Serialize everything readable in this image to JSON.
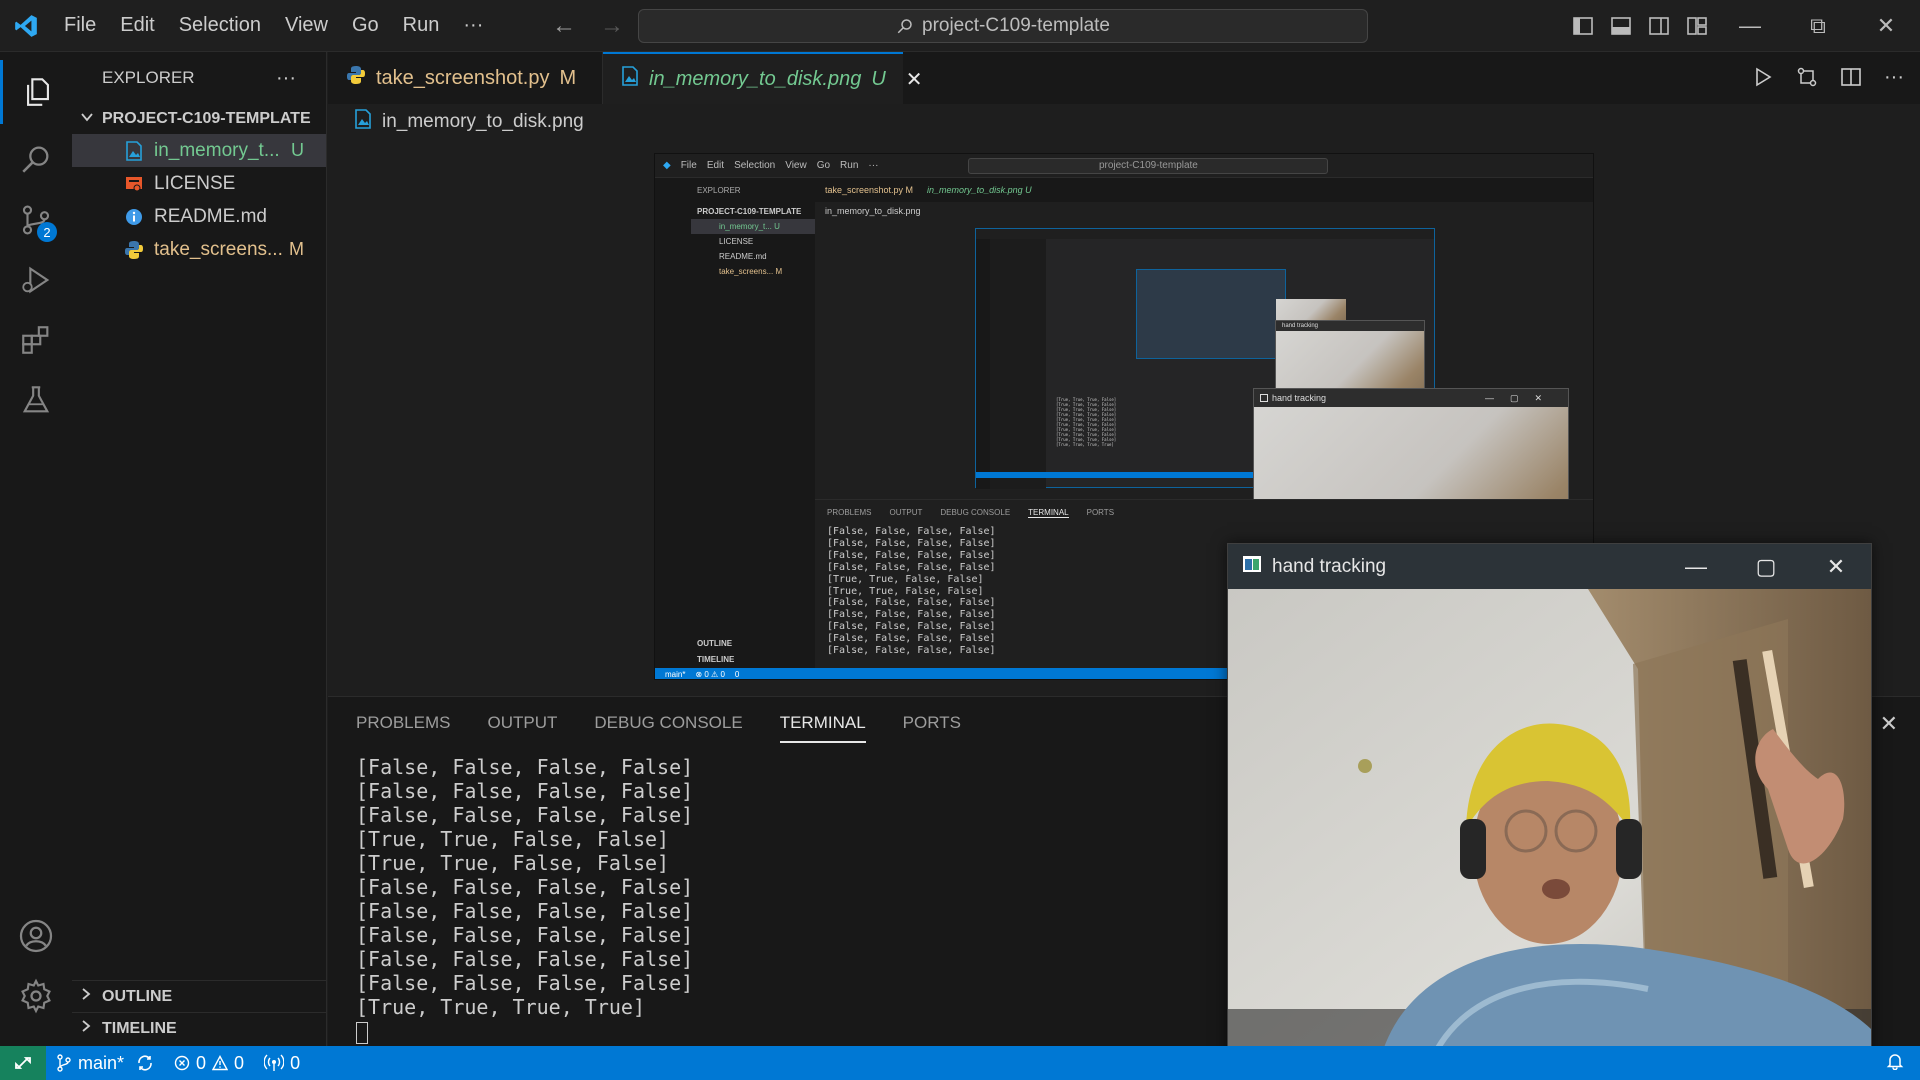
{
  "titlebar": {
    "menu": [
      "File",
      "Edit",
      "Selection",
      "View",
      "Go",
      "Run",
      "···"
    ],
    "search_text": "project-C109-template",
    "nav_back": "←",
    "nav_forward": "→",
    "win_minimize": "—",
    "win_restore": "⧉",
    "win_close": "✕"
  },
  "activity_bar": {
    "items": [
      "explorer-icon",
      "search-icon",
      "source-control-icon",
      "run-debug-icon",
      "extensions-icon",
      "testing-icon"
    ],
    "source_control_badge": "2",
    "bottom": [
      "account-icon",
      "settings-gear-icon"
    ]
  },
  "sidebar": {
    "header": "EXPLORER",
    "header_more": "···",
    "project": "PROJECT-C109-TEMPLATE",
    "files": [
      {
        "name": "in_memory_t...",
        "status": "U",
        "icon": "image-file-icon"
      },
      {
        "name": "LICENSE",
        "status": "",
        "icon": "license-file-icon"
      },
      {
        "name": "README.md",
        "status": "",
        "icon": "info-file-icon"
      },
      {
        "name": "take_screens...",
        "status": "M",
        "icon": "python-file-icon"
      }
    ],
    "outline": "OUTLINE",
    "timeline": "TIMELINE"
  },
  "tabs": [
    {
      "label": "take_screenshot.py",
      "status": "M"
    },
    {
      "label": "in_memory_to_disk.png",
      "status": "U",
      "close": "✕"
    }
  ],
  "breadcrumb": "in_memory_to_disk.png",
  "preview": {
    "title_search": "project-C109-template",
    "menu": [
      "File",
      "Edit",
      "Selection",
      "View",
      "Go",
      "Run",
      "···"
    ],
    "explorer": "EXPLORER",
    "project": "PROJECT-C109-TEMPLATE",
    "files": [
      "in_memory_t...  U",
      "LICENSE",
      "README.md",
      "take_screens...  M"
    ],
    "tab1": "take_screenshot.py  M",
    "tab2": "in_memory_to_disk.png  U",
    "breadcrumb": "in_memory_to_disk.png",
    "panel_tabs": [
      "PROBLEMS",
      "OUTPUT",
      "DEBUG CONSOLE",
      "TERMINAL",
      "PORTS"
    ],
    "terminal_lines": [
      "[False, False, False, False]",
      "[False, False, False, False]",
      "[False, False, False, False]",
      "[False, False, False, False]",
      "[True, True, False, False]",
      "[True, True, False, False]",
      "[False, False, False, False]",
      "[False, False, False, False]",
      "[False, False, False, False]",
      "[False, False, False, False]",
      "[False, False, False, False]"
    ],
    "outline": "OUTLINE",
    "timeline": "TIMELINE",
    "status": [
      "main*",
      "⊗ 0 ⚠ 0",
      "0"
    ],
    "hand_win_title": "hand tracking",
    "nested_hand_title": "hand tracking"
  },
  "panel": {
    "tabs": [
      "PROBLEMS",
      "OUTPUT",
      "DEBUG CONSOLE",
      "TERMINAL",
      "PORTS"
    ],
    "active_tab": "TERMINAL",
    "close": "✕",
    "terminal_lines": [
      "[False, False, False, False]",
      "[False, False, False, False]",
      "[False, False, False, False]",
      "[True, True, False, False]",
      "[True, True, False, False]",
      "[False, False, False, False]",
      "[False, False, False, False]",
      "[False, False, False, False]",
      "[False, False, False, False]",
      "[False, False, False, False]",
      "[True, True, True, True]"
    ]
  },
  "hand_window": {
    "title": "hand tracking",
    "minimize": "—",
    "maximize": "▢",
    "close": "✕"
  },
  "statusbar": {
    "branch": "main*",
    "errors": "0",
    "warnings": "0",
    "ports": "0"
  },
  "colors": {
    "accent": "#0078d4",
    "untracked": "#73c991",
    "modified": "#e2c08d",
    "remote": "#16825d"
  }
}
